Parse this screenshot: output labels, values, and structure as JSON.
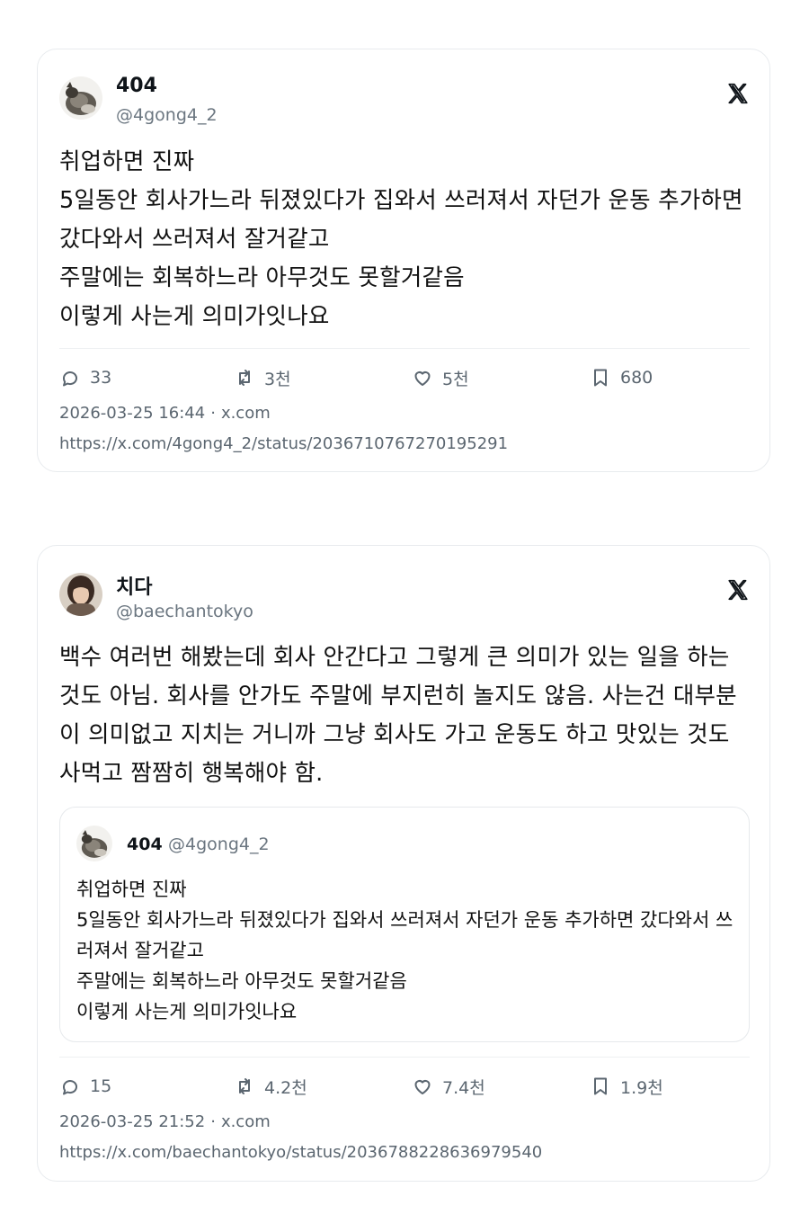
{
  "tweets": [
    {
      "author": {
        "name": "404",
        "handle": "@4gong4_2"
      },
      "text": "취업하면 진짜\n5일동안 회사가느라 뒤졌있다가 집와서 쓰러져서 자던가 운동 추가하면 갔다와서 쓰러져서 잘거같고\n주말에는 회복하느라 아무것도 못할거같음\n이렇게 사는게 의미가잇나요",
      "stats": {
        "replies": "33",
        "retweets": "3천",
        "likes": "5천",
        "bookmarks": "680"
      },
      "timestamp": "2026-03-25 16:44",
      "source": "x.com",
      "url": "https://x.com/4gong4_2/status/2036710767270195291"
    },
    {
      "author": {
        "name": "치다",
        "handle": "@baechantokyo"
      },
      "text": "백수 여러번 해봤는데 회사 안간다고 그렇게 큰 의미가 있는 일을 하는 것도 아님. 회사를 안가도 주말에 부지런히 놀지도 않음. 사는건 대부분이 의미없고 지치는 거니까 그냥 회사도 가고 운동도 하고 맛있는 것도 사먹고 짬짬히 행복해야 함.",
      "quoted": {
        "name": "404",
        "handle": "@4gong4_2",
        "text": "취업하면 진짜\n5일동안 회사가느라 뒤졌있다가 집와서 쓰러져서 자던가 운동 추가하면 갔다와서 쓰러져서 잘거같고\n주말에는 회복하느라 아무것도 못할거같음\n이렇게 사는게 의미가잇나요"
      },
      "stats": {
        "replies": "15",
        "retweets": "4.2천",
        "likes": "7.4천",
        "bookmarks": "1.9천"
      },
      "timestamp": "2026-03-25 21:52",
      "source": "x.com",
      "url": "https://x.com/baechantokyo/status/2036788228636979540"
    }
  ],
  "meta_separator": "·",
  "icons": {
    "logo": "x-logo-icon",
    "reply": "reply-icon",
    "retweet": "retweet-icon",
    "like": "heart-icon",
    "bookmark": "bookmark-icon"
  },
  "colors": {
    "text": "#0f1419",
    "muted": "#5b6670",
    "border": "#e8ebee"
  }
}
